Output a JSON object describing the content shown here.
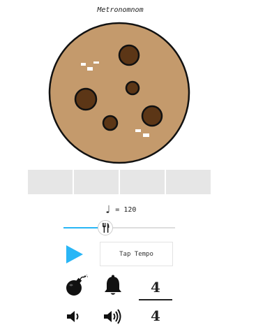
{
  "app": {
    "title": "Metronomnom"
  },
  "tempo": {
    "note_symbol": "♩",
    "equals": "=",
    "bpm": "120"
  },
  "slider": {
    "value": 120,
    "min": 30,
    "max": 270,
    "fill_color": "#29b6f6"
  },
  "beats": {
    "count": 4
  },
  "controls": {
    "tap_label": "Tap Tempo",
    "accent_color": "#29b6f6"
  },
  "time_signature": {
    "numerator": "4",
    "denominator": "4"
  },
  "icons": {
    "play": "play-icon",
    "bomb": "bomb-icon",
    "bell": "bell-icon",
    "volume_down": "volume-down-icon",
    "volume_up": "volume-up-icon",
    "fork_knife": "fork-knife-icon"
  },
  "colors": {
    "cookie": "#c49a6c",
    "chip": "#5c3616",
    "beat_cell": "#e6e6e6"
  }
}
